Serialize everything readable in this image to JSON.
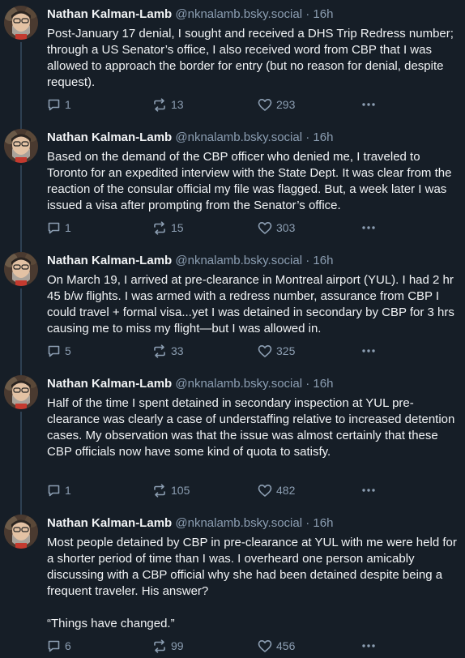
{
  "colors": {
    "background": "#161e27",
    "text": "#f1f3f5",
    "muted": "#8c9eb2",
    "thread_line": "#2e4052"
  },
  "author": {
    "name": "Nathan Kalman-Lamb",
    "handle": "@nknalamb.bsky.social",
    "separator": "·",
    "time": "16h"
  },
  "icons": {
    "reply": "reply-bubble-icon",
    "repost": "repost-arrows-icon",
    "like": "heart-icon",
    "more": "more-dots-icon"
  },
  "posts": [
    {
      "paragraphs": [
        "Post-January 17 denial, I sought and received a DHS Trip Redress number; through a US Senator’s office, I also received word from CBP that I was allowed to approach the border for entry (but no reason for denial, despite request)."
      ],
      "replies": "1",
      "reposts": "13",
      "likes": "293"
    },
    {
      "paragraphs": [
        "Based on the demand of the CBP officer who denied me, I traveled to Toronto for an expedited interview with the State Dept. It was clear from the reaction of the consular official my file was flagged. But, a week later I was issued a visa after prompting from the Senator’s office."
      ],
      "replies": "1",
      "reposts": "15",
      "likes": "303"
    },
    {
      "paragraphs": [
        "On March 19, I arrived at pre-clearance in Montreal airport (YUL). I had 2 hr 45 b/w flights. I was armed with a redress number, assurance from CBP I could travel + formal visa...yet I was detained in secondary by CBP for 3 hrs causing me to miss my flight—but I was allowed in."
      ],
      "replies": "5",
      "reposts": "33",
      "likes": "325"
    },
    {
      "paragraphs": [
        "Half of the time I spent detained in secondary inspection at YUL pre-clearance was clearly a case of understaffing relative to increased detention cases. My observation was that the issue was almost certainly that these CBP officials now have some kind of quota to satisfy."
      ],
      "replies": "1",
      "reposts": "105",
      "likes": "482"
    },
    {
      "paragraphs": [
        "Most people detained by CBP in pre-clearance at YUL with me were held for a shorter period of time than I was. I overheard one person amicably discussing with a CBP official why she had been detained despite being a frequent traveler. His answer?",
        "“Things have changed.”"
      ],
      "replies": "6",
      "reposts": "99",
      "likes": "456"
    }
  ]
}
